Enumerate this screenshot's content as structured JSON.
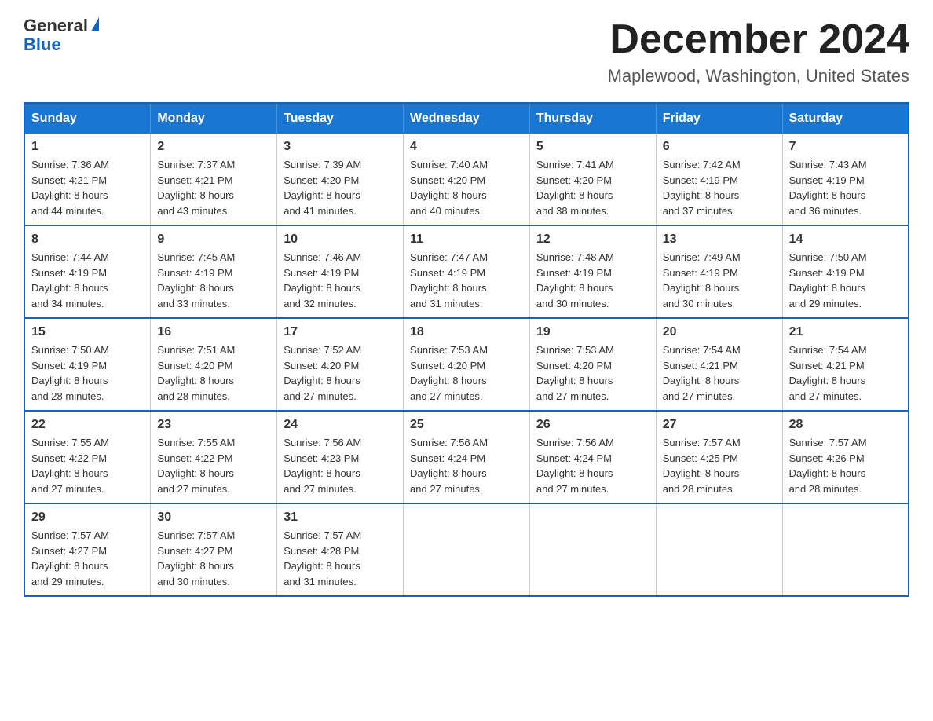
{
  "logo": {
    "general": "General",
    "blue": "Blue"
  },
  "title": "December 2024",
  "subtitle": "Maplewood, Washington, United States",
  "days_of_week": [
    "Sunday",
    "Monday",
    "Tuesday",
    "Wednesday",
    "Thursday",
    "Friday",
    "Saturday"
  ],
  "weeks": [
    [
      {
        "day": "1",
        "sunrise": "7:36 AM",
        "sunset": "4:21 PM",
        "daylight": "8 hours and 44 minutes."
      },
      {
        "day": "2",
        "sunrise": "7:37 AM",
        "sunset": "4:21 PM",
        "daylight": "8 hours and 43 minutes."
      },
      {
        "day": "3",
        "sunrise": "7:39 AM",
        "sunset": "4:20 PM",
        "daylight": "8 hours and 41 minutes."
      },
      {
        "day": "4",
        "sunrise": "7:40 AM",
        "sunset": "4:20 PM",
        "daylight": "8 hours and 40 minutes."
      },
      {
        "day": "5",
        "sunrise": "7:41 AM",
        "sunset": "4:20 PM",
        "daylight": "8 hours and 38 minutes."
      },
      {
        "day": "6",
        "sunrise": "7:42 AM",
        "sunset": "4:19 PM",
        "daylight": "8 hours and 37 minutes."
      },
      {
        "day": "7",
        "sunrise": "7:43 AM",
        "sunset": "4:19 PM",
        "daylight": "8 hours and 36 minutes."
      }
    ],
    [
      {
        "day": "8",
        "sunrise": "7:44 AM",
        "sunset": "4:19 PM",
        "daylight": "8 hours and 34 minutes."
      },
      {
        "day": "9",
        "sunrise": "7:45 AM",
        "sunset": "4:19 PM",
        "daylight": "8 hours and 33 minutes."
      },
      {
        "day": "10",
        "sunrise": "7:46 AM",
        "sunset": "4:19 PM",
        "daylight": "8 hours and 32 minutes."
      },
      {
        "day": "11",
        "sunrise": "7:47 AM",
        "sunset": "4:19 PM",
        "daylight": "8 hours and 31 minutes."
      },
      {
        "day": "12",
        "sunrise": "7:48 AM",
        "sunset": "4:19 PM",
        "daylight": "8 hours and 30 minutes."
      },
      {
        "day": "13",
        "sunrise": "7:49 AM",
        "sunset": "4:19 PM",
        "daylight": "8 hours and 30 minutes."
      },
      {
        "day": "14",
        "sunrise": "7:50 AM",
        "sunset": "4:19 PM",
        "daylight": "8 hours and 29 minutes."
      }
    ],
    [
      {
        "day": "15",
        "sunrise": "7:50 AM",
        "sunset": "4:19 PM",
        "daylight": "8 hours and 28 minutes."
      },
      {
        "day": "16",
        "sunrise": "7:51 AM",
        "sunset": "4:20 PM",
        "daylight": "8 hours and 28 minutes."
      },
      {
        "day": "17",
        "sunrise": "7:52 AM",
        "sunset": "4:20 PM",
        "daylight": "8 hours and 27 minutes."
      },
      {
        "day": "18",
        "sunrise": "7:53 AM",
        "sunset": "4:20 PM",
        "daylight": "8 hours and 27 minutes."
      },
      {
        "day": "19",
        "sunrise": "7:53 AM",
        "sunset": "4:20 PM",
        "daylight": "8 hours and 27 minutes."
      },
      {
        "day": "20",
        "sunrise": "7:54 AM",
        "sunset": "4:21 PM",
        "daylight": "8 hours and 27 minutes."
      },
      {
        "day": "21",
        "sunrise": "7:54 AM",
        "sunset": "4:21 PM",
        "daylight": "8 hours and 27 minutes."
      }
    ],
    [
      {
        "day": "22",
        "sunrise": "7:55 AM",
        "sunset": "4:22 PM",
        "daylight": "8 hours and 27 minutes."
      },
      {
        "day": "23",
        "sunrise": "7:55 AM",
        "sunset": "4:22 PM",
        "daylight": "8 hours and 27 minutes."
      },
      {
        "day": "24",
        "sunrise": "7:56 AM",
        "sunset": "4:23 PM",
        "daylight": "8 hours and 27 minutes."
      },
      {
        "day": "25",
        "sunrise": "7:56 AM",
        "sunset": "4:24 PM",
        "daylight": "8 hours and 27 minutes."
      },
      {
        "day": "26",
        "sunrise": "7:56 AM",
        "sunset": "4:24 PM",
        "daylight": "8 hours and 27 minutes."
      },
      {
        "day": "27",
        "sunrise": "7:57 AM",
        "sunset": "4:25 PM",
        "daylight": "8 hours and 28 minutes."
      },
      {
        "day": "28",
        "sunrise": "7:57 AM",
        "sunset": "4:26 PM",
        "daylight": "8 hours and 28 minutes."
      }
    ],
    [
      {
        "day": "29",
        "sunrise": "7:57 AM",
        "sunset": "4:27 PM",
        "daylight": "8 hours and 29 minutes."
      },
      {
        "day": "30",
        "sunrise": "7:57 AM",
        "sunset": "4:27 PM",
        "daylight": "8 hours and 30 minutes."
      },
      {
        "day": "31",
        "sunrise": "7:57 AM",
        "sunset": "4:28 PM",
        "daylight": "8 hours and 31 minutes."
      },
      null,
      null,
      null,
      null
    ]
  ],
  "labels": {
    "sunrise": "Sunrise:",
    "sunset": "Sunset:",
    "daylight": "Daylight:"
  }
}
